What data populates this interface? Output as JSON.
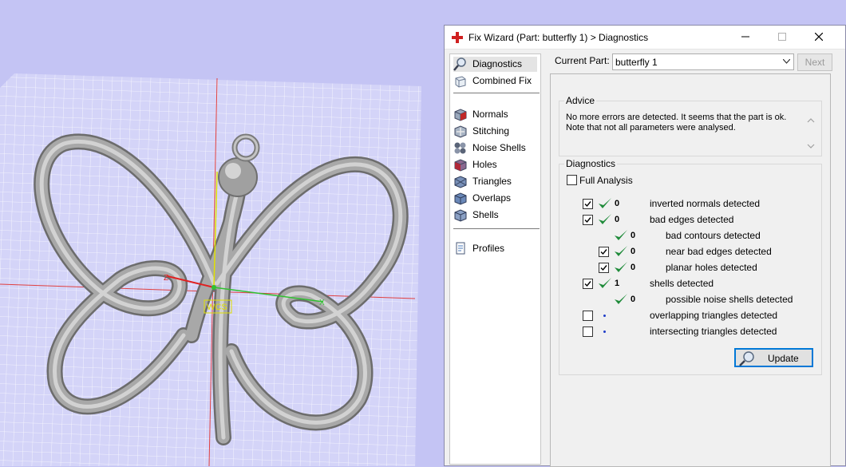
{
  "window": {
    "title": "Fix Wizard (Part: butterfly 1) > Diagnostics"
  },
  "nav": {
    "items": [
      {
        "label": "Diagnostics",
        "icon": "magnifier-icon",
        "active": true
      },
      {
        "label": "Combined Fix",
        "icon": "cube-icon"
      },
      {
        "label": "Normals",
        "icon": "normals-cube-icon"
      },
      {
        "label": "Stitching",
        "icon": "stitching-icon"
      },
      {
        "label": "Noise Shells",
        "icon": "noise-shells-icon"
      },
      {
        "label": "Holes",
        "icon": "holes-cube-icon"
      },
      {
        "label": "Triangles",
        "icon": "triangles-icon"
      },
      {
        "label": "Overlaps",
        "icon": "overlaps-icon"
      },
      {
        "label": "Shells",
        "icon": "shells-icon"
      },
      {
        "label": "Profiles",
        "icon": "profiles-icon"
      }
    ]
  },
  "part": {
    "label": "Current Part:",
    "value": "butterfly 1",
    "next_label": "Next"
  },
  "advice": {
    "title": "Advice",
    "line1": "No more errors are detected. It seems that the part is ok.",
    "line2": "Note that not all parameters were analysed."
  },
  "diagnostics": {
    "title": "Diagnostics",
    "full_analysis_label": "Full Analysis",
    "full_analysis_checked": false,
    "rows": [
      {
        "checked": true,
        "status": "ok",
        "count": "0",
        "label": "inverted normals detected",
        "indent": 0,
        "has_checkbox": true
      },
      {
        "checked": true,
        "status": "ok",
        "count": "0",
        "label": "bad edges detected",
        "indent": 0,
        "has_checkbox": true
      },
      {
        "checked": false,
        "status": "ok",
        "count": "0",
        "label": "bad contours detected",
        "indent": 1,
        "has_checkbox": false
      },
      {
        "checked": true,
        "status": "ok",
        "count": "0",
        "label": "near bad edges detected",
        "indent": 1,
        "has_checkbox": true
      },
      {
        "checked": true,
        "status": "ok",
        "count": "0",
        "label": "planar holes detected",
        "indent": 1,
        "has_checkbox": true
      },
      {
        "checked": true,
        "status": "ok",
        "count": "1",
        "label": "shells detected",
        "indent": 0,
        "has_checkbox": true
      },
      {
        "checked": false,
        "status": "ok",
        "count": "0",
        "label": "possible noise shells detected",
        "indent": 1,
        "has_checkbox": false
      },
      {
        "checked": false,
        "status": "pending",
        "count": "",
        "label": "overlapping triangles detected",
        "indent": 0,
        "has_checkbox": true
      },
      {
        "checked": false,
        "status": "pending",
        "count": "",
        "label": "intersecting triangles detected",
        "indent": 0,
        "has_checkbox": true
      }
    ],
    "update_label": "Update"
  },
  "viewport": {
    "wcs_label": "WCS",
    "axis_x_label": "X",
    "axis_z_label": "Z"
  },
  "colors": {
    "background": "#c4c4f4",
    "grid_line": "#ffffff",
    "check_green": "#1f8b3a",
    "accent_blue": "#0078d7",
    "close_red": "#d02020"
  }
}
